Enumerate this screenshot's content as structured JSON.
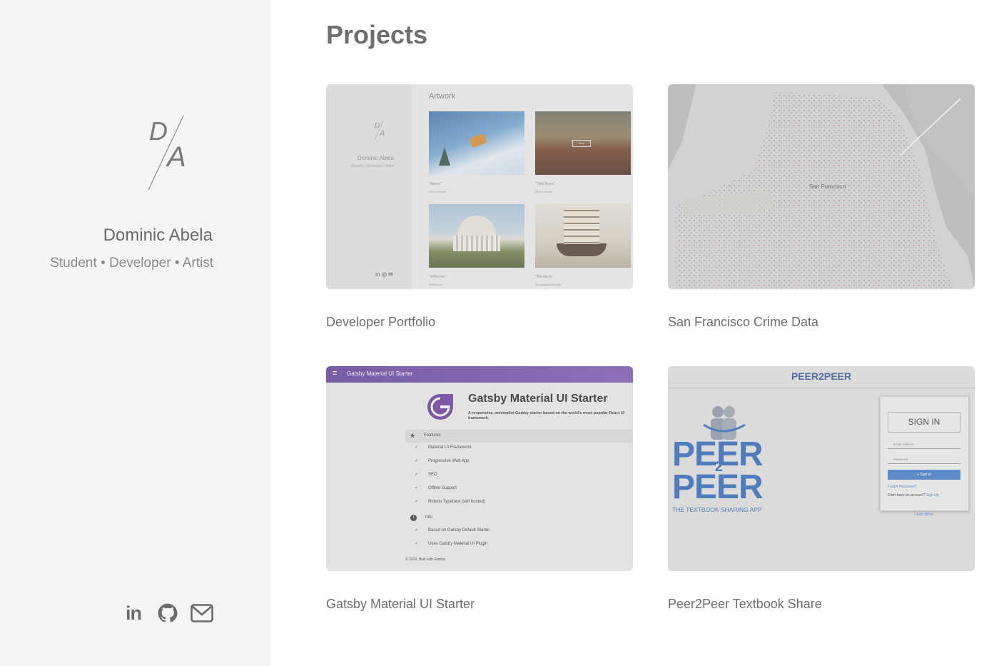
{
  "profile": {
    "monogram_top": "D",
    "monogram_bottom": "A",
    "name": "Dominic Abela",
    "tagline": "Student • Developer • Artist"
  },
  "social": [
    {
      "name": "linkedin-icon",
      "glyph": "in"
    },
    {
      "name": "github-icon"
    },
    {
      "name": "email-icon"
    }
  ],
  "main": {
    "section_title": "Projects",
    "projects": [
      {
        "title": "Developer Portfolio",
        "preview": {
          "heading": "Artwork",
          "name": "Dominic Abela",
          "tagline": "Student • Developer • Artist",
          "artworks": [
            {
              "title": "\"Alpine\"",
              "medium": "Oil on canvas"
            },
            {
              "title": "\"Tidal Basin\"",
              "medium": "Oil on canvas"
            },
            {
              "title": "\"Jefferson\"",
              "medium": "Watercolor"
            },
            {
              "title": "\"Wanderer\"",
              "medium": "Typography/ceramic"
            }
          ]
        }
      },
      {
        "title": "San Francisco Crime Data",
        "preview": {
          "city_label": "San Francisco"
        }
      },
      {
        "title": "Gatsby Material UI Starter",
        "preview": {
          "bar_title": "Gatsby Material UI Starter",
          "heading": "Gatsby Material UI Starter",
          "subheading": "A responsive, minimalist Gatsby starter based on the world's most popular React UI framework.",
          "features_label": "Features",
          "features": [
            "Material UI Framework",
            "Progressive Web App",
            "SEO",
            "Offline Support",
            "Roboto Typeface (self hosted)"
          ],
          "info_label": "Info",
          "info": [
            "Based on Gatsby Default Starter",
            "Uses Gatsby Material UI Plugin"
          ],
          "footer": "© 2019, Built with Gatsby"
        }
      },
      {
        "title": "Peer2Peer Textbook Share",
        "preview": {
          "brand": "PEER2PEER",
          "logo_line1": "PEER",
          "logo_mid": "2",
          "logo_line2": "PEER",
          "logo_sub": "THE TEXTBOOK SHARING APP",
          "sign_in_title": "SIGN IN",
          "email_placeholder": "Email Address",
          "password_placeholder": "Password",
          "sign_in_button": "+ Sign In",
          "forgot": "Forgot Password?",
          "no_account": "Don't have an account?",
          "sign_up": "Sign Up",
          "learn_more": "Learn More"
        }
      }
    ]
  },
  "colors": {
    "sidebar_bg": "#f5f5f5",
    "text": "#6e6e6e",
    "gatsby_purple": "#663399",
    "peer_blue": "#2a63b8"
  }
}
